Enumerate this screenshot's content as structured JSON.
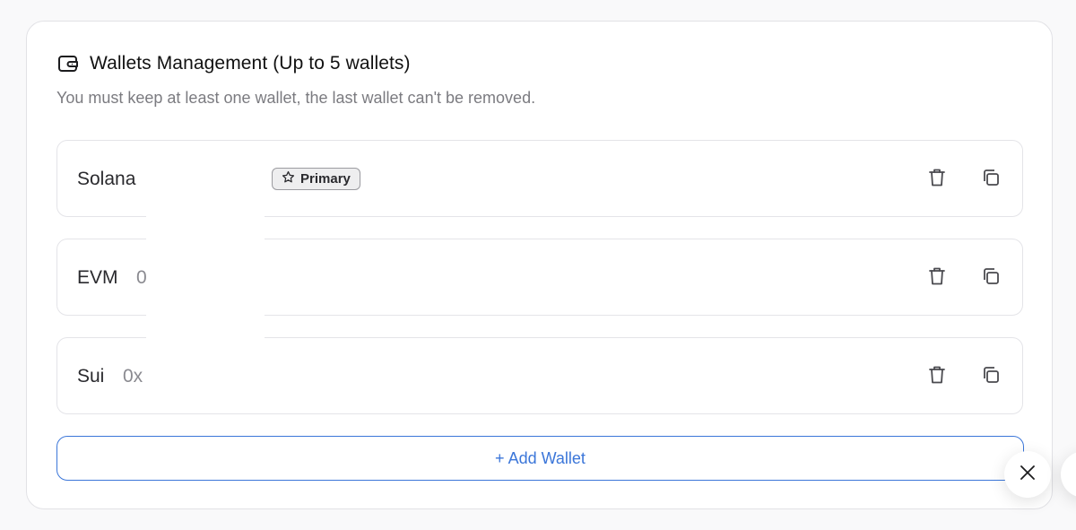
{
  "panel": {
    "title": "Wallets Management (Up to 5 wallets)",
    "subtitle": "You must keep at least one wallet, the last wallet can't be removed.",
    "icon": "wallet-icon"
  },
  "wallets": [
    {
      "chain": "Solana",
      "address": "",
      "badge": "Primary",
      "badge_icon": "star-icon",
      "delete_icon": "trash-icon",
      "copy_icon": "copy-icon"
    },
    {
      "chain": "EVM",
      "address": "0",
      "delete_icon": "trash-icon",
      "copy_icon": "copy-icon"
    },
    {
      "chain": "Sui",
      "address": "0x",
      "delete_icon": "trash-icon",
      "copy_icon": "copy-icon"
    }
  ],
  "add_button": {
    "label": "+ Add Wallet"
  },
  "close_button": {
    "icon": "close-icon"
  },
  "colors": {
    "accent": "#3b76d9",
    "border": "#e4e4e8",
    "muted_text": "#7b7b80"
  }
}
